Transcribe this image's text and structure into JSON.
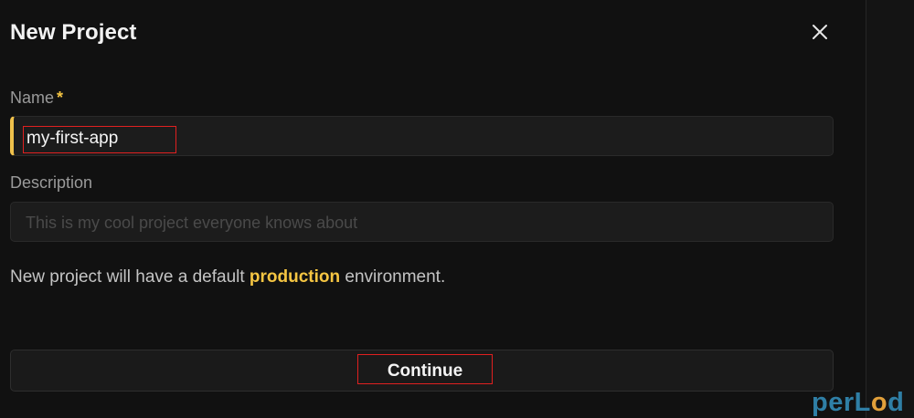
{
  "dialog": {
    "title": "New Project",
    "close_icon": "close-icon"
  },
  "form": {
    "name": {
      "label": "Name",
      "required_mark": "*",
      "value": "my-first-app"
    },
    "description": {
      "label": "Description",
      "placeholder": "This is my cool project everyone knows about",
      "value": ""
    },
    "info": {
      "prefix": "New project will have a default",
      "highlight": "production",
      "suffix": "environment."
    },
    "continue_label": "Continue"
  },
  "watermark": {
    "text_before": "perL",
    "text_o": "o",
    "text_after": "d"
  },
  "colors": {
    "accent": "#f5c542",
    "annotation": "#e02020",
    "background": "#111111"
  }
}
